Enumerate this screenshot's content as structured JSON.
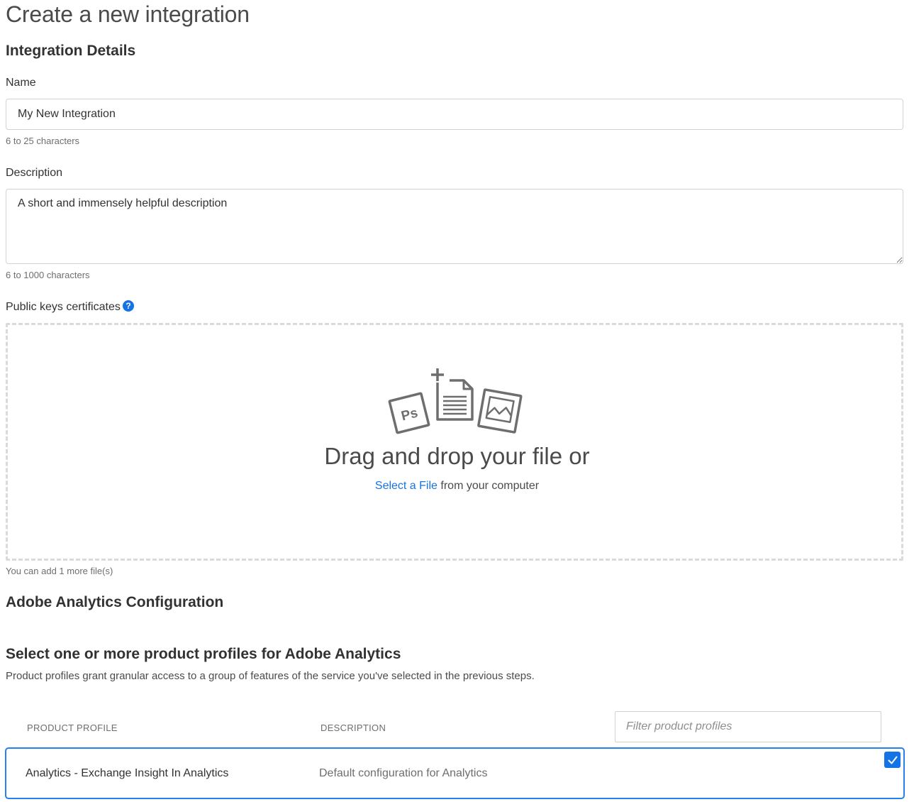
{
  "page": {
    "title": "Create a new integration"
  },
  "integration_details": {
    "heading": "Integration Details",
    "name": {
      "label": "Name",
      "value": "My New Integration",
      "hint": "6 to 25 characters"
    },
    "description": {
      "label": "Description",
      "value": "A short and immensely helpful description",
      "hint": "6 to 1000 characters"
    },
    "public_keys": {
      "label": "Public keys certificates",
      "help_icon": "?"
    },
    "dropzone": {
      "title": "Drag and drop your file or",
      "link_text": "Select a File",
      "suffix": "from your computer",
      "illustration_icons": [
        "photoshop-file-icon",
        "add-document-icon",
        "image-file-icon"
      ]
    },
    "files_remaining": "You can add 1 more file(s)"
  },
  "analytics_config": {
    "heading": "Adobe Analytics Configuration"
  },
  "profiles": {
    "heading": "Select one or more product profiles for Adobe Analytics",
    "description": "Product profiles grant granular access to a group of features of the service you've selected in the previous steps.",
    "columns": {
      "profile": "PRODUCT PROFILE",
      "description": "DESCRIPTION"
    },
    "filter_placeholder": "Filter product profiles",
    "rows": [
      {
        "name": "Analytics - Exchange Insight In Analytics",
        "description": "Default configuration for Analytics",
        "selected": true
      }
    ]
  },
  "colors": {
    "accent": "#1473e6",
    "selected_border": "#2680eb",
    "dropzone_border": "#dadada"
  }
}
